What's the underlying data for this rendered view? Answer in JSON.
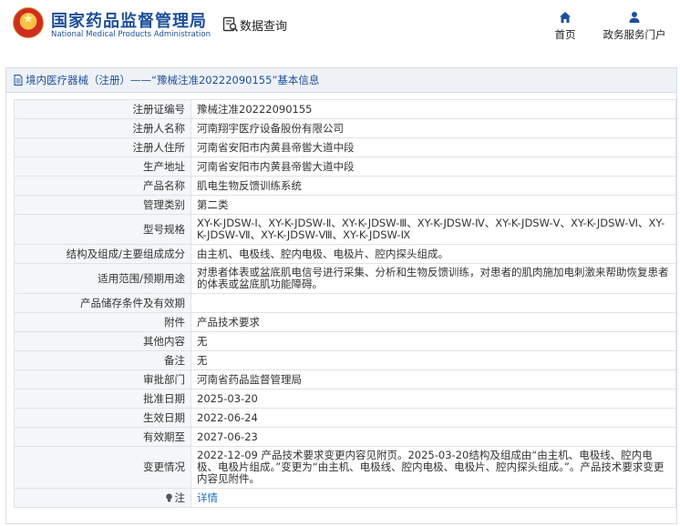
{
  "header": {
    "logo_cn": "国家药品监督管理局",
    "logo_en": "National Medical Products Administration",
    "search_label": "数据查询",
    "nav": [
      {
        "label": "首页",
        "icon": "home-icon"
      },
      {
        "label": "政务服务门户",
        "icon": "user-icon"
      }
    ]
  },
  "panel": {
    "title": "境内医疗器械（注册）——“豫械注准20222090155”基本信息"
  },
  "fields": [
    {
      "key": "注册证编号",
      "value": "豫械注准20222090155"
    },
    {
      "key": "注册人名称",
      "value": "河南翔宇医疗设备股份有限公司"
    },
    {
      "key": "注册人住所",
      "value": "河南省安阳市内黄县帝喾大道中段"
    },
    {
      "key": "生产地址",
      "value": "河南省安阳市内黄县帝喾大道中段"
    },
    {
      "key": "产品名称",
      "value": "肌电生物反馈训练系统"
    },
    {
      "key": "管理类别",
      "value": "第二类"
    },
    {
      "key": "型号规格",
      "value": "XY-K-JDSW-Ⅰ、XY-K-JDSW-Ⅱ、XY-K-JDSW-Ⅲ、XY-K-JDSW-Ⅳ、XY-K-JDSW-Ⅴ、XY-K-JDSW-Ⅵ、XY-K-JDSW-Ⅶ、XY-K-JDSW-Ⅷ、XY-K-JDSW-Ⅸ"
    },
    {
      "key": "结构及组成/主要组成成分",
      "value": "由主机、电极线、腔内电极、电极片、腔内探头组成。"
    },
    {
      "key": "适用范围/预期用途",
      "value": "对患者体表或盆底肌电信号进行采集、分析和生物反馈训练，对患者的肌肉施加电刺激来帮助恢复患者的体表或盆底肌功能障碍。"
    },
    {
      "key": "产品储存条件及有效期",
      "value": ""
    },
    {
      "key": "附件",
      "value": "产品技术要求"
    },
    {
      "key": "其他内容",
      "value": "无"
    },
    {
      "key": "备注",
      "value": "无"
    },
    {
      "key": "审批部门",
      "value": "河南省药品监督管理局"
    },
    {
      "key": "批准日期",
      "value": "2025-03-20"
    },
    {
      "key": "生效日期",
      "value": "2022-06-24"
    },
    {
      "key": "有效期至",
      "value": "2027-06-23"
    },
    {
      "key": "变更情况",
      "value": "2022-12-09 产品技术要求变更内容见附页。2025-03-20结构及组成由“由主机、电极线、腔内电极、电极片组成。”变更为“由主机、电极线、腔内电极、电极片、腔内探头组成。”。产品技术要求变更内容见附件。"
    }
  ],
  "note": {
    "key": "注",
    "link": "详情",
    "icon": "lightbulb-icon"
  }
}
